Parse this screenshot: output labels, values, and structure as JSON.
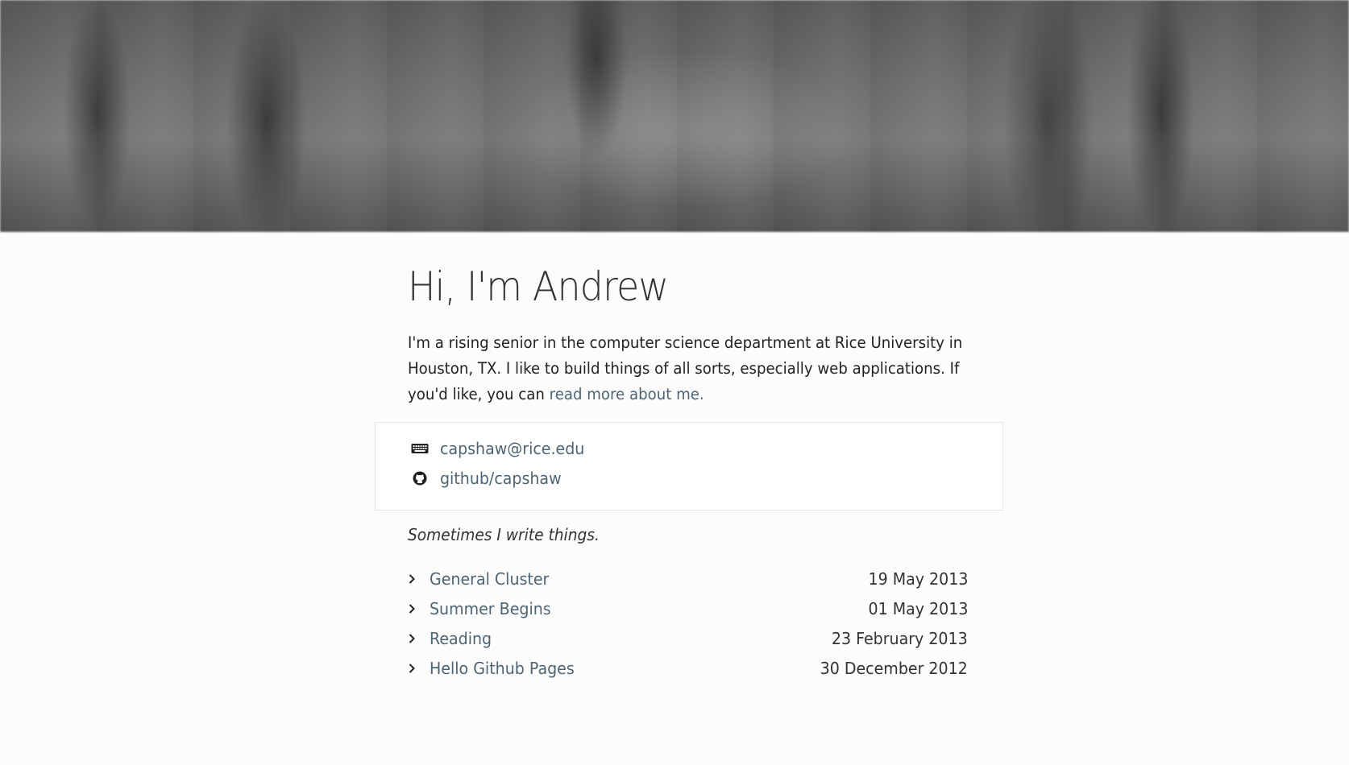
{
  "header": {
    "heading": "Hi, I'm Andrew"
  },
  "intro": {
    "text_before_link": "I'm a rising senior in the computer science department at Rice University in Houston, TX. I like to build things of all sorts, especially web applications. If you'd like, you can ",
    "link_label": "read more about me."
  },
  "contact": {
    "email": {
      "icon": "keyboard-icon",
      "label": "capshaw@rice.edu"
    },
    "github": {
      "icon": "github-icon",
      "label": "github/capshaw"
    }
  },
  "writing": {
    "tagline": "Sometimes I write things.",
    "posts": [
      {
        "title": "General Cluster",
        "date": "19 May 2013"
      },
      {
        "title": "Summer Begins",
        "date": "01 May 2013"
      },
      {
        "title": "Reading",
        "date": "23 February 2013"
      },
      {
        "title": "Hello Github Pages",
        "date": "30 December 2012"
      }
    ]
  },
  "colors": {
    "link": "#4e6472",
    "text": "#222222",
    "background": "#fcfcfd"
  }
}
